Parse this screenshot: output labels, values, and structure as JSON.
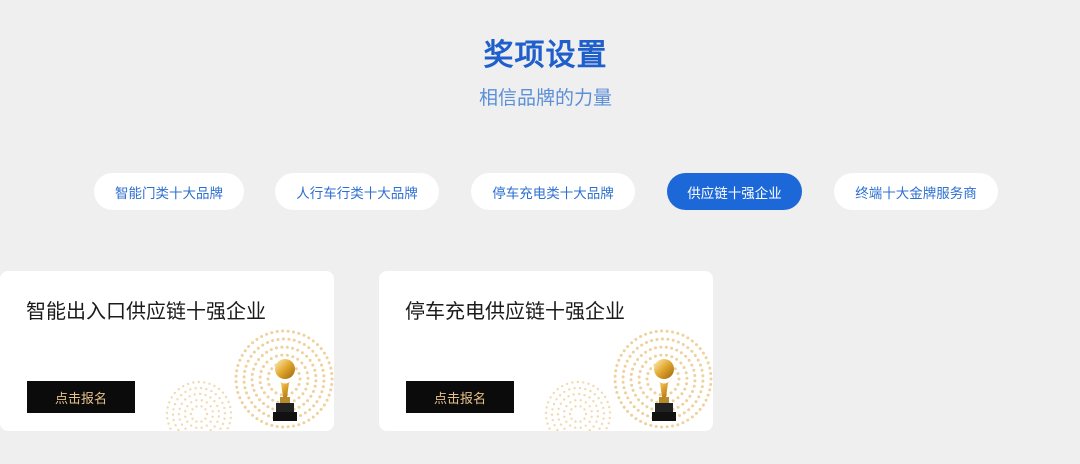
{
  "header": {
    "title": "奖项设置",
    "subtitle": "相信品牌的力量"
  },
  "tabs": [
    {
      "label": "智能门类十大品牌",
      "active": false
    },
    {
      "label": "人行车行类十大品牌",
      "active": false
    },
    {
      "label": "停车充电类十大品牌",
      "active": false
    },
    {
      "label": "供应链十强企业",
      "active": true
    },
    {
      "label": "终端十大金牌服务商",
      "active": false
    }
  ],
  "cards": [
    {
      "title": "智能出入口供应链十强企业",
      "button_label": "点击报名",
      "icon": "trophy-icon"
    },
    {
      "title": "停车充电供应链十强企业",
      "button_label": "点击报名",
      "icon": "trophy-icon"
    }
  ],
  "colors": {
    "title": "#1f5fcc",
    "accent": "#1d68d8",
    "button_bg": "#0b0b0b",
    "button_text": "#e7c38a",
    "gold": "#e8c27a"
  }
}
